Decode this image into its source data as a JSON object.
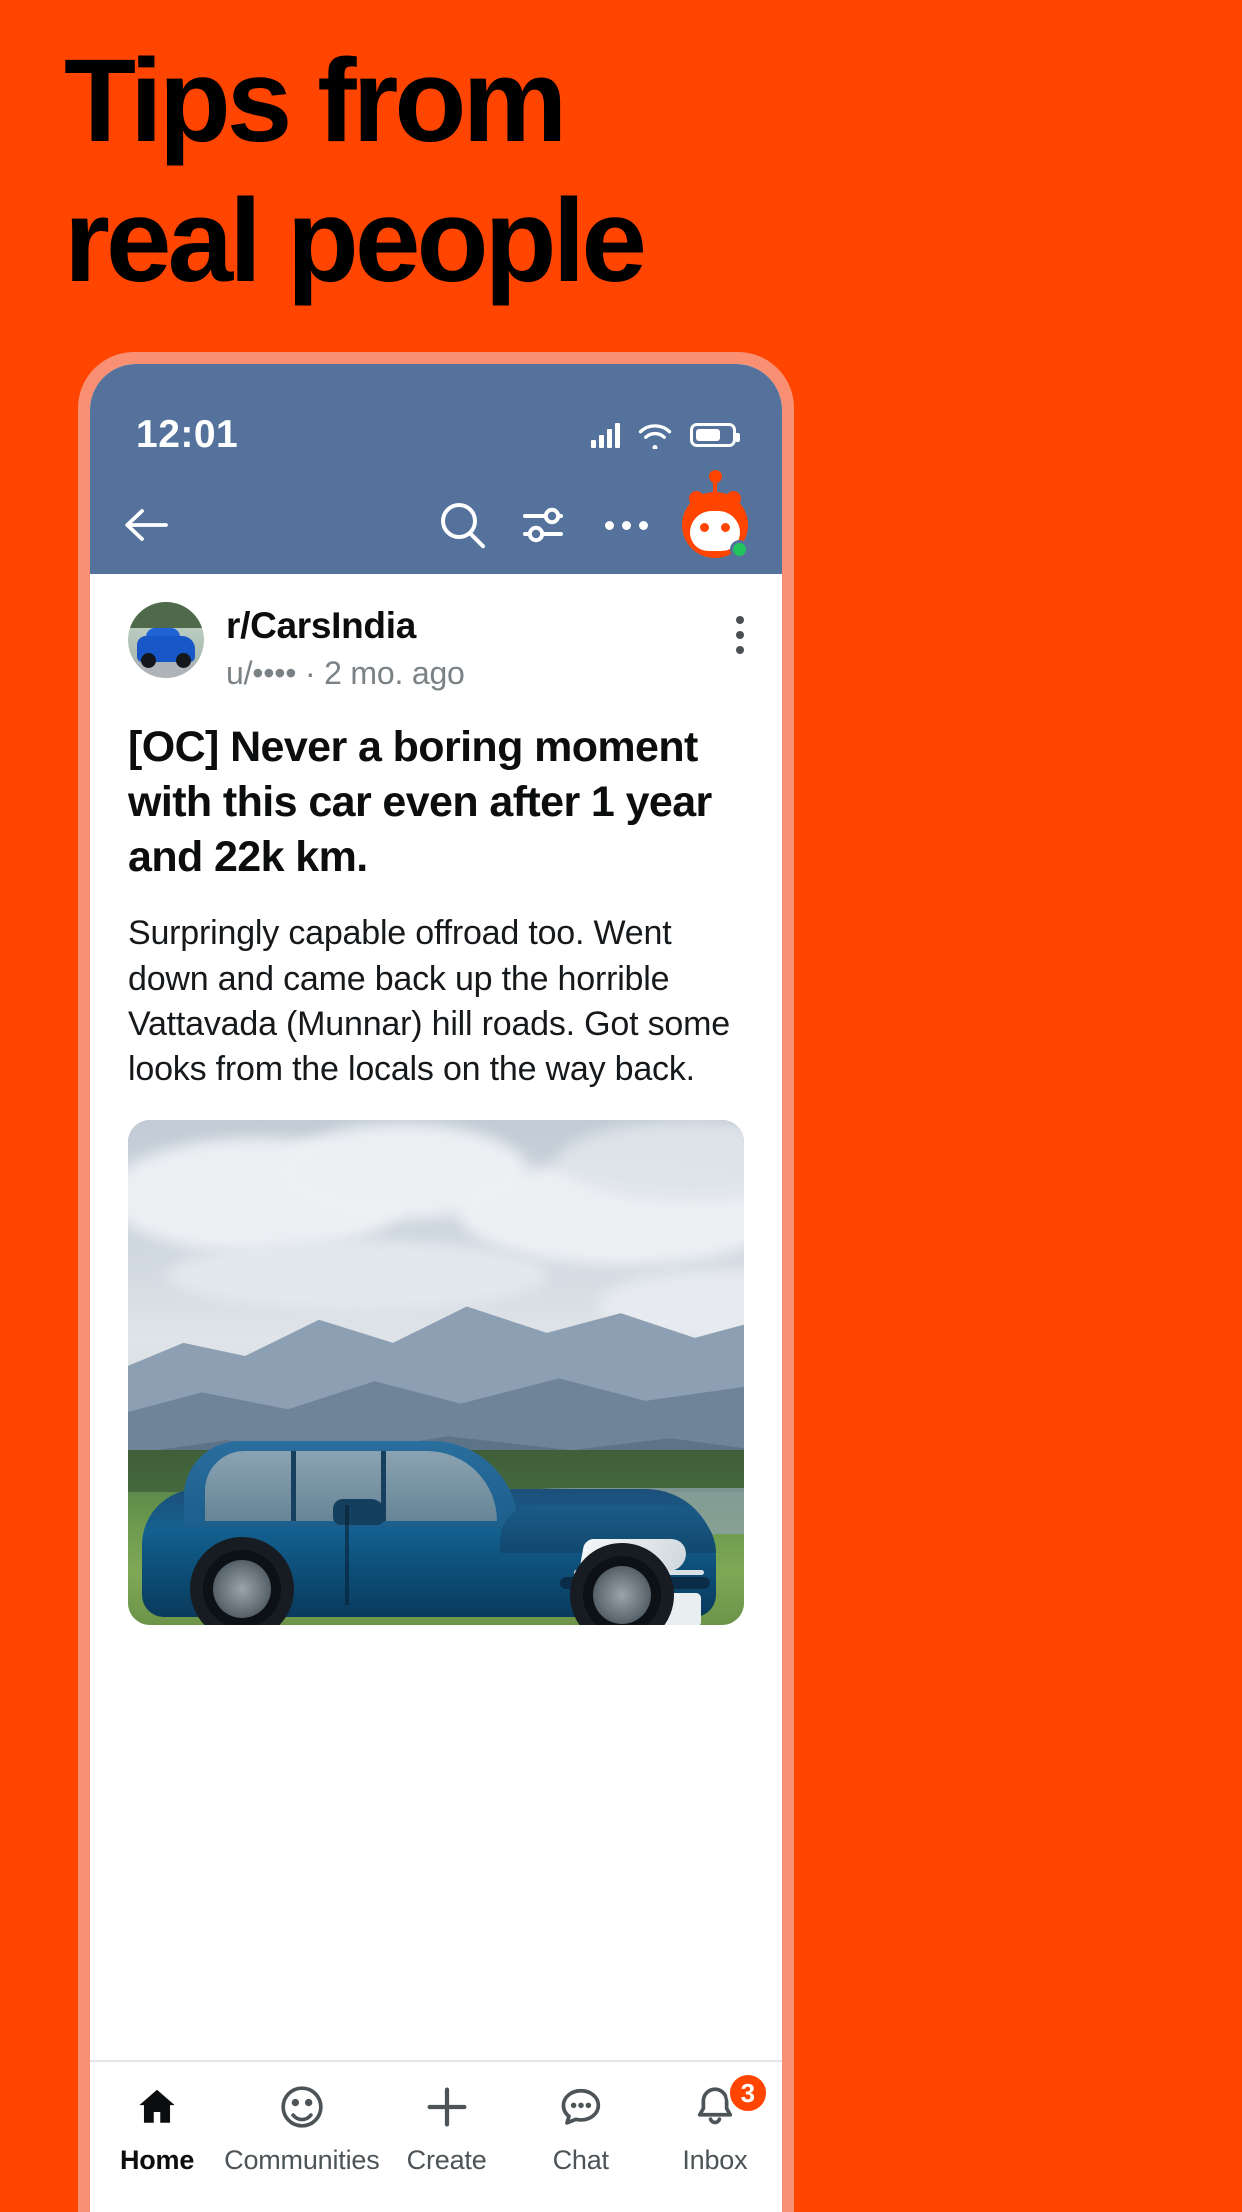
{
  "theme": {
    "background_orange": "#FF4500",
    "phone_border": "#FA9073",
    "header_blue": "#54729B",
    "badge_red": "#FF4500",
    "online_green": "#21C45D"
  },
  "headline": {
    "line1": "Tips from",
    "line2": "real people"
  },
  "status_bar": {
    "time": "12:01",
    "icons": [
      "cellular-signal-icon",
      "wifi-icon",
      "battery-icon"
    ]
  },
  "nav_bar": {
    "back_icon": "back-arrow-icon",
    "search_icon": "search-icon",
    "filter_icon": "filter-sliders-icon",
    "more_icon": "more-horizontal-icon",
    "avatar_icon": "reddit-snoo-avatar"
  },
  "post": {
    "subreddit": "r/CarsIndia",
    "byline": "u/•••• · 2 mo. ago",
    "overflow_icon": "more-vertical-icon",
    "title": "[OC] Never a boring moment with this car even after 1 year and 22k km.",
    "body": "Surpringly capable offroad too. Went down and came back up the horrible Vattavada (Munnar) hill roads. Got some looks from the locals on the way back.",
    "image_alt": "blue-sedan-in-grass-field-with-mountains"
  },
  "bottom_nav": {
    "items": [
      {
        "label": "Home",
        "icon": "home-icon",
        "active": true,
        "badge": ""
      },
      {
        "label": "Communities",
        "icon": "communities-icon",
        "active": false,
        "badge": ""
      },
      {
        "label": "Create",
        "icon": "plus-icon",
        "active": false,
        "badge": ""
      },
      {
        "label": "Chat",
        "icon": "chat-bubble-icon",
        "active": false,
        "badge": ""
      },
      {
        "label": "Inbox",
        "icon": "bell-icon",
        "active": false,
        "badge": "3"
      }
    ]
  }
}
